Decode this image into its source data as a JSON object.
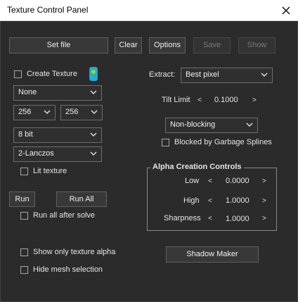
{
  "window": {
    "title": "Texture Control Panel",
    "close_icon": "close-icon"
  },
  "toolbar": {
    "set_file": "Set file",
    "clear": "Clear",
    "options": "Options",
    "save": "Save",
    "show": "Show"
  },
  "texture": {
    "create_label": "Create Texture",
    "create_checked": false,
    "indicator_icon": "toggle-indicator-icon",
    "source": "None",
    "width": "256",
    "height": "256",
    "bit_depth": "8 bit",
    "filter": "2-Lanczos",
    "lit_label": "Lit texture",
    "lit_checked": false
  },
  "extract": {
    "label": "Extract:",
    "value": "Best pixel",
    "tilt_label": "Tilt Limit",
    "tilt_value": "0.1000",
    "dec": "<",
    "inc": ">",
    "blocking": "Non-blocking",
    "blocked_label": "Blocked by Garbage Splines",
    "blocked_checked": false
  },
  "run": {
    "run": "Run",
    "run_all": "Run All",
    "after_solve_label": "Run all after solve",
    "after_solve_checked": false
  },
  "alpha": {
    "title": "Alpha Creation Controls",
    "rows": [
      {
        "label": "Low",
        "value": "0.0000",
        "dec": "<",
        "inc": ">"
      },
      {
        "label": "High",
        "value": "1.0000",
        "dec": "<",
        "inc": ">"
      },
      {
        "label": "Sharpness",
        "value": "1.0000",
        "dec": "<",
        "inc": ">"
      }
    ]
  },
  "bottom": {
    "show_alpha_label": "Show only texture alpha",
    "hide_mesh_label": "Hide mesh selection",
    "shadow_maker": "Shadow Maker"
  }
}
